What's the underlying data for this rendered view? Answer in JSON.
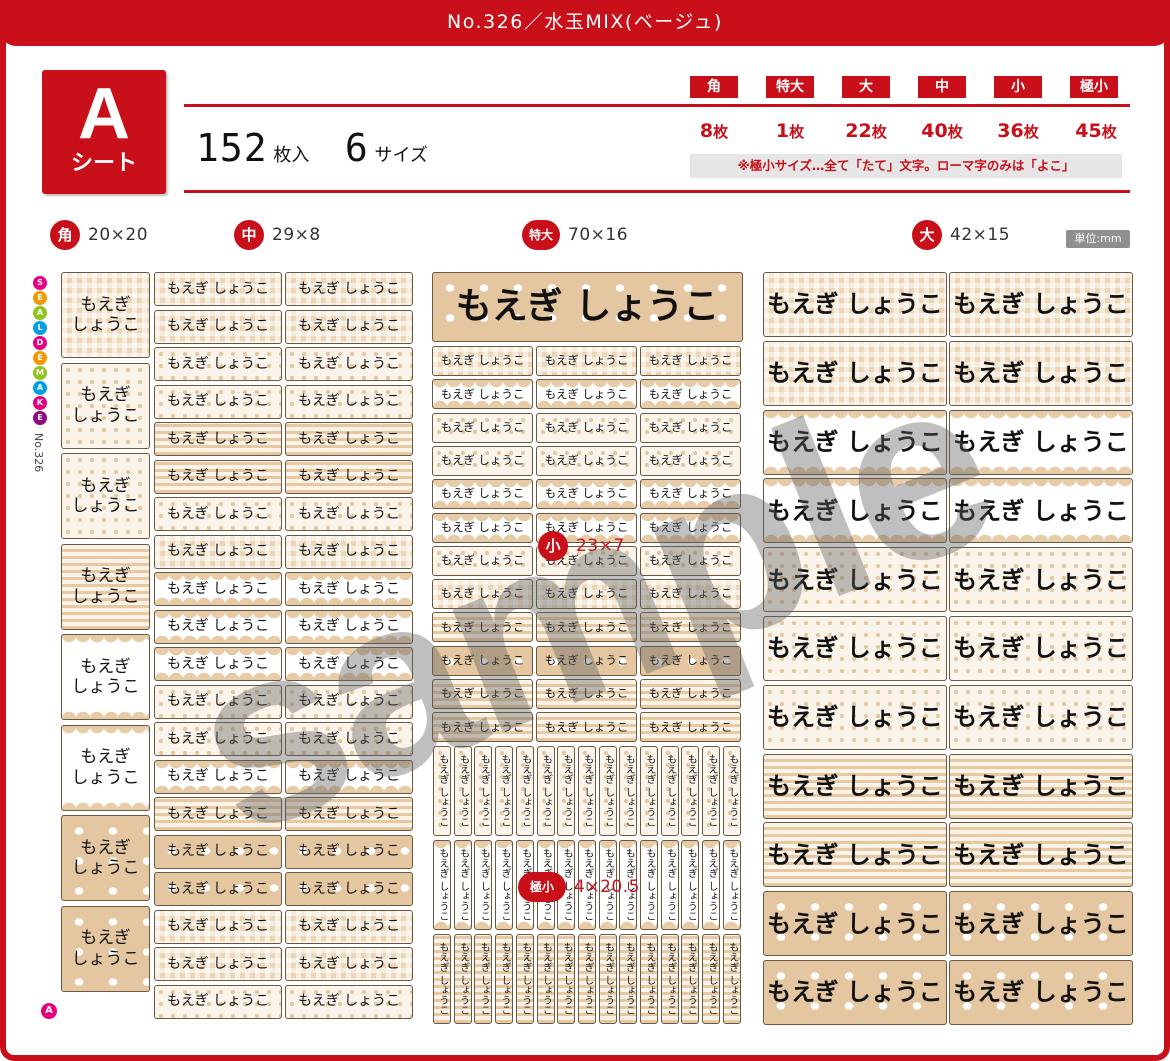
{
  "header": {
    "title": "No.326／水玉MIX(ベージュ)",
    "sheet_letter": "A",
    "sheet_word": "シート",
    "count_number": "152",
    "count_unit": "枚入",
    "size_number": "6",
    "size_unit": "サイズ",
    "note": "※極小サイズ…全て「たて」文字。ローマ字のみは「よこ」"
  },
  "sizes": [
    {
      "tag": "角",
      "count": "8",
      "unit": "枚"
    },
    {
      "tag": "特大",
      "count": "1",
      "unit": "枚"
    },
    {
      "tag": "大",
      "count": "22",
      "unit": "枚"
    },
    {
      "tag": "中",
      "count": "40",
      "unit": "枚"
    },
    {
      "tag": "小",
      "count": "36",
      "unit": "枚"
    },
    {
      "tag": "極小",
      "count": "45",
      "unit": "枚"
    }
  ],
  "sections": {
    "kaku": {
      "tag": "角",
      "dim": "20×20"
    },
    "chu": {
      "tag": "中",
      "dim": "29×8"
    },
    "tokudai": {
      "tag": "特大",
      "dim": "70×16"
    },
    "dai": {
      "tag": "大",
      "dim": "42×15"
    },
    "sho": {
      "tag": "小",
      "dim": "23×7"
    },
    "gokusho": {
      "tag": "極小",
      "dim": "4×20.5"
    }
  },
  "unit_label": "単位:mm",
  "label_name": "もえぎ しょうこ",
  "label_name_line1": "もえぎ",
  "label_name_line2": "しょうこ",
  "side_logo": {
    "letters": [
      "S",
      "E",
      "A",
      "L",
      "D",
      "E",
      "M",
      "A",
      "K",
      "E"
    ],
    "number": "No.326",
    "colors": [
      "#e4007f",
      "#f39800",
      "#8fc31f",
      "#00a0e9",
      "#e4007f",
      "#f39800",
      "#8fc31f",
      "#00a0e9",
      "#e4007f",
      "#920783"
    ]
  },
  "corner_mark": "A",
  "watermark": "sample",
  "colors": {
    "brand_red": "#c9101a",
    "beige": "#e5c9a4"
  }
}
